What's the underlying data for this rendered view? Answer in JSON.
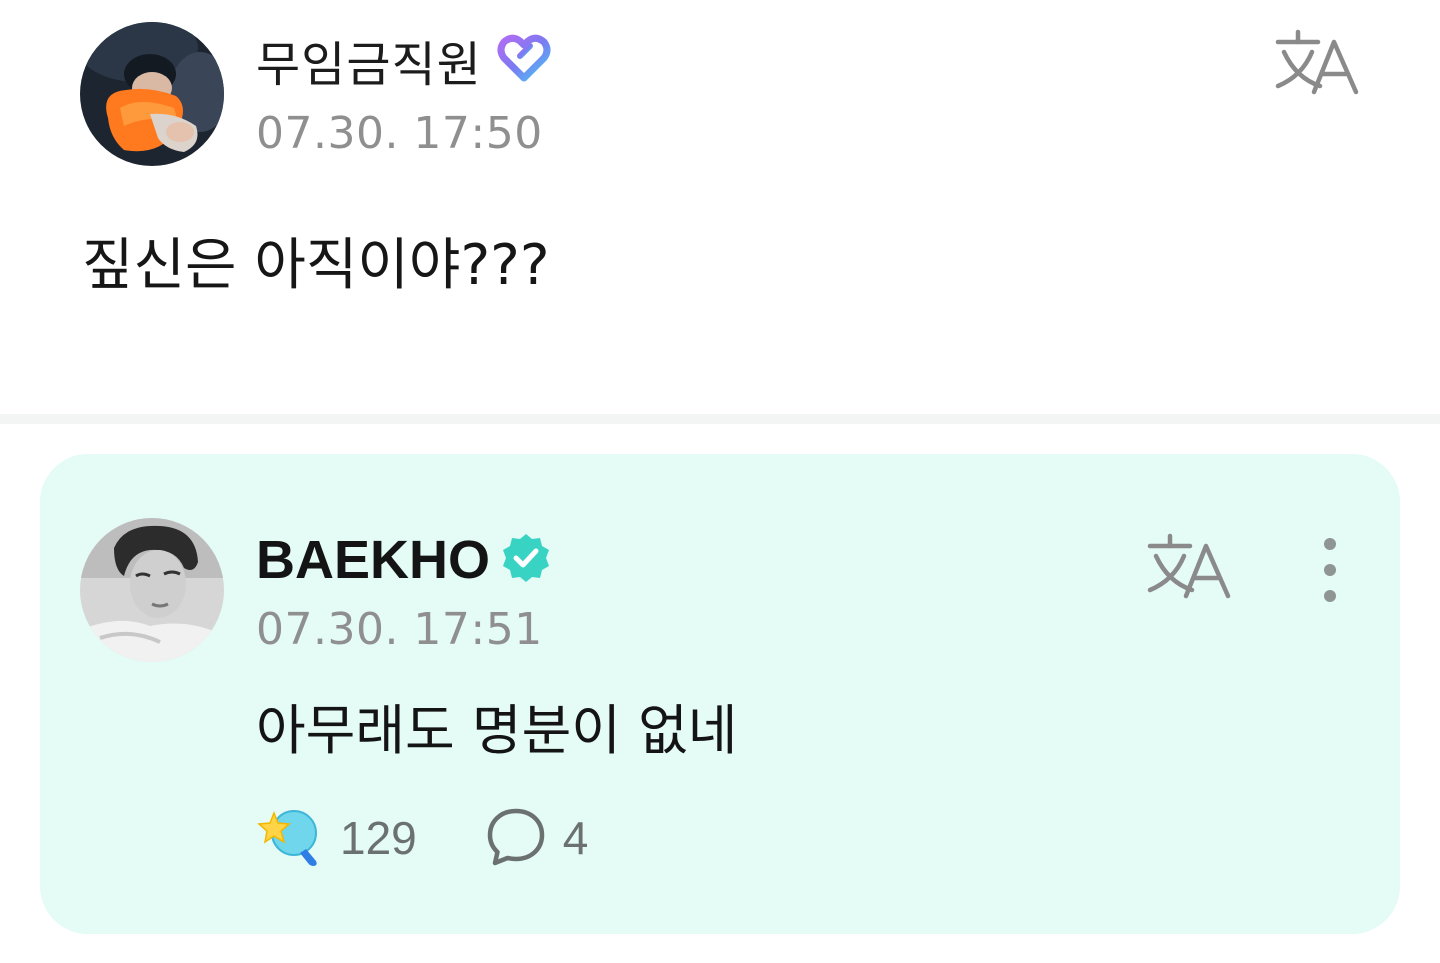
{
  "post": {
    "author": "무임금직원",
    "time": "07.30. 17:50",
    "body": "짚신은 아직이야???",
    "icons": {
      "badge": "membership-heart-badge-icon",
      "translate": "translate-icon"
    }
  },
  "reply": {
    "author": "BAEKHO",
    "time": "07.30. 17:51",
    "body": "아무래도 명분이 없네",
    "likes": "129",
    "comments": "4",
    "icons": {
      "badge": "verified-check-icon",
      "translate": "translate-icon",
      "more": "more-vertical-icon",
      "like": "star-lightstick-icon",
      "comment": "speech-bubble-icon"
    }
  },
  "colors": {
    "reply_background": "#e4fbf6",
    "verified": "#39d3c4",
    "badge_purple": "#8a6cf0",
    "badge_blue": "#4fb8f6",
    "muted_text": "#8f8f8f"
  }
}
